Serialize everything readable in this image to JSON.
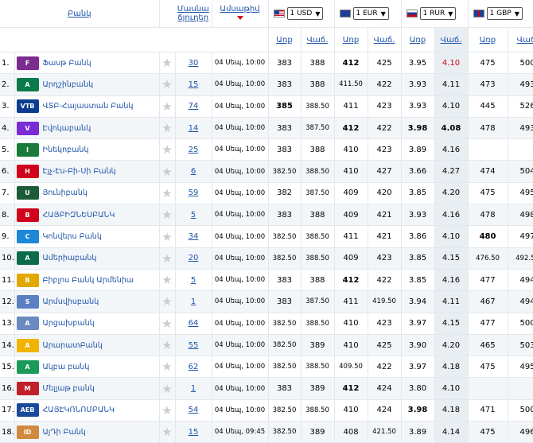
{
  "header": {
    "bank": "Բանկ",
    "rating_line1": "Մասնա",
    "rating_line2": "ճյուղեր",
    "date": "Ամսաթիվ",
    "buy": "Առք",
    "sell": "Վաճ.",
    "currencies": [
      {
        "label": "1 USD",
        "flag": "us"
      },
      {
        "label": "1 EUR",
        "flag": "eu"
      },
      {
        "label": "1 RUR",
        "flag": "ru"
      },
      {
        "label": "1 GBP",
        "flag": "gb"
      }
    ]
  },
  "rows": [
    {
      "idx": "1.",
      "name": "Ֆասթ Բանկ",
      "logo": "F",
      "logo_color": "#7b2c8f",
      "branches": "30",
      "date": "04 Սեպ, 10:00",
      "vals": [
        "383",
        "388",
        "412",
        "425",
        "3.95",
        "4.10",
        "475",
        "500"
      ]
    },
    {
      "idx": "2.",
      "name": "Արդշինբանկ",
      "logo": "A",
      "logo_color": "#0b7a4b",
      "branches": "15",
      "date": "04 Սեպ, 10:00",
      "vals": [
        "383",
        "388",
        "411.50",
        "422",
        "3.93",
        "4.11",
        "473",
        "493"
      ]
    },
    {
      "idx": "3.",
      "name": "ՎՏԲ-Հայաստան Բանկ",
      "logo": "VTB",
      "logo_color": "#0a3d8f",
      "branches": "74",
      "date": "04 Սեպ, 10:00",
      "vals": [
        "385",
        "388.50",
        "411",
        "423",
        "3.93",
        "4.10",
        "445",
        "526"
      ]
    },
    {
      "idx": "4.",
      "name": "Էվոկաբանկ",
      "logo": "V",
      "logo_color": "#7a2bd6",
      "branches": "14",
      "date": "04 Սեպ, 10:00",
      "vals": [
        "383",
        "387.50",
        "412",
        "422",
        "3.98",
        "4.08",
        "478",
        "493"
      ]
    },
    {
      "idx": "5.",
      "name": "Ինեկոբանկ",
      "logo": "I",
      "logo_color": "#1a7a3a",
      "branches": "25",
      "date": "04 Սեպ, 10:00",
      "vals": [
        "383",
        "388",
        "410",
        "423",
        "3.89",
        "4.16",
        "",
        ""
      ]
    },
    {
      "idx": "6.",
      "name": "Էյչ-Էս-Բի-Սի Բանկ",
      "logo": "H",
      "logo_color": "#d0021b",
      "branches": "6",
      "date": "04 Սեպ, 10:00",
      "vals": [
        "382.50",
        "388.50",
        "410",
        "427",
        "3.66",
        "4.27",
        "474",
        "504"
      ]
    },
    {
      "idx": "7.",
      "name": "Յունիբանկ",
      "logo": "U",
      "logo_color": "#1c5a3a",
      "branches": "59",
      "date": "04 Սեպ, 10:00",
      "vals": [
        "382",
        "387.50",
        "409",
        "420",
        "3.85",
        "4.20",
        "475",
        "495"
      ]
    },
    {
      "idx": "8.",
      "name": "ՀԱՅԲԻԶՆԵՍԲԱՆԿ",
      "logo": "B",
      "logo_color": "#d0021b",
      "branches": "5",
      "date": "04 Սեպ, 10:00",
      "vals": [
        "383",
        "388",
        "409",
        "421",
        "3.93",
        "4.16",
        "478",
        "498"
      ]
    },
    {
      "idx": "9.",
      "name": "Կոնվերս Բանկ",
      "logo": "C",
      "logo_color": "#1e88d8",
      "branches": "34",
      "date": "04 Սեպ, 10:00",
      "vals": [
        "382.50",
        "388.50",
        "411",
        "421",
        "3.86",
        "4.10",
        "480",
        "497"
      ]
    },
    {
      "idx": "10.",
      "name": "Ամերիաբանկ",
      "logo": "A",
      "logo_color": "#0b6b4a",
      "branches": "20",
      "date": "04 Սեպ, 10:00",
      "vals": [
        "382.50",
        "388.50",
        "409",
        "423",
        "3.85",
        "4.15",
        "476.50",
        "492.50"
      ]
    },
    {
      "idx": "11.",
      "name": "Բիբլոս Բանկ Արմենիա",
      "logo": "B",
      "logo_color": "#e0a800",
      "branches": "5",
      "date": "04 Սեպ, 10:00",
      "vals": [
        "383",
        "388",
        "412",
        "422",
        "3.85",
        "4.16",
        "477",
        "494"
      ]
    },
    {
      "idx": "12.",
      "name": "Արմսվիսբանկ",
      "logo": "S",
      "logo_color": "#5a7fc2",
      "branches": "1",
      "date": "04 Սեպ, 10:00",
      "vals": [
        "383",
        "387.50",
        "411",
        "419.50",
        "3.94",
        "4.11",
        "467",
        "494"
      ]
    },
    {
      "idx": "13.",
      "name": "Արցախբանկ",
      "logo": "A",
      "logo_color": "#6a8ac0",
      "branches": "64",
      "date": "04 Սեպ, 10:00",
      "vals": [
        "382.50",
        "388.50",
        "410",
        "423",
        "3.97",
        "4.15",
        "477",
        "500"
      ]
    },
    {
      "idx": "14.",
      "name": "ԱրարատԲանկ",
      "logo": "A",
      "logo_color": "#f0b400",
      "branches": "55",
      "date": "04 Սեպ, 10:00",
      "vals": [
        "382.50",
        "389",
        "410",
        "425",
        "3.90",
        "4.20",
        "465",
        "503"
      ]
    },
    {
      "idx": "15.",
      "name": "Ակբա բանկ",
      "logo": "A",
      "logo_color": "#1a9a5a",
      "branches": "62",
      "date": "04 Սեպ, 10:00",
      "vals": [
        "382.50",
        "388.50",
        "409.50",
        "422",
        "3.97",
        "4.18",
        "475",
        "495"
      ]
    },
    {
      "idx": "16.",
      "name": "Մելլաթ բանկ",
      "logo": "M",
      "logo_color": "#c0202a",
      "branches": "1",
      "date": "04 Սեպ, 10:00",
      "vals": [
        "383",
        "389",
        "412",
        "424",
        "3.80",
        "4.10",
        "",
        ""
      ]
    },
    {
      "idx": "17.",
      "name": "ՀԱՅԷԿՈՆՈՄԲԱՆԿ",
      "logo": "AEB",
      "logo_color": "#1a4a9a",
      "branches": "54",
      "date": "04 Սեպ, 10:00",
      "vals": [
        "382.50",
        "388.50",
        "410",
        "424",
        "3.98",
        "4.18",
        "471",
        "500"
      ]
    },
    {
      "idx": "18.",
      "name": "ԱյԴի Բանկ",
      "logo": "ID",
      "logo_color": "#d08a40",
      "branches": "15",
      "date": "04 Սեպ, 09:45",
      "vals": [
        "382.50",
        "389",
        "408",
        "421.50",
        "3.89",
        "4.14",
        "475",
        "496"
      ]
    }
  ]
}
